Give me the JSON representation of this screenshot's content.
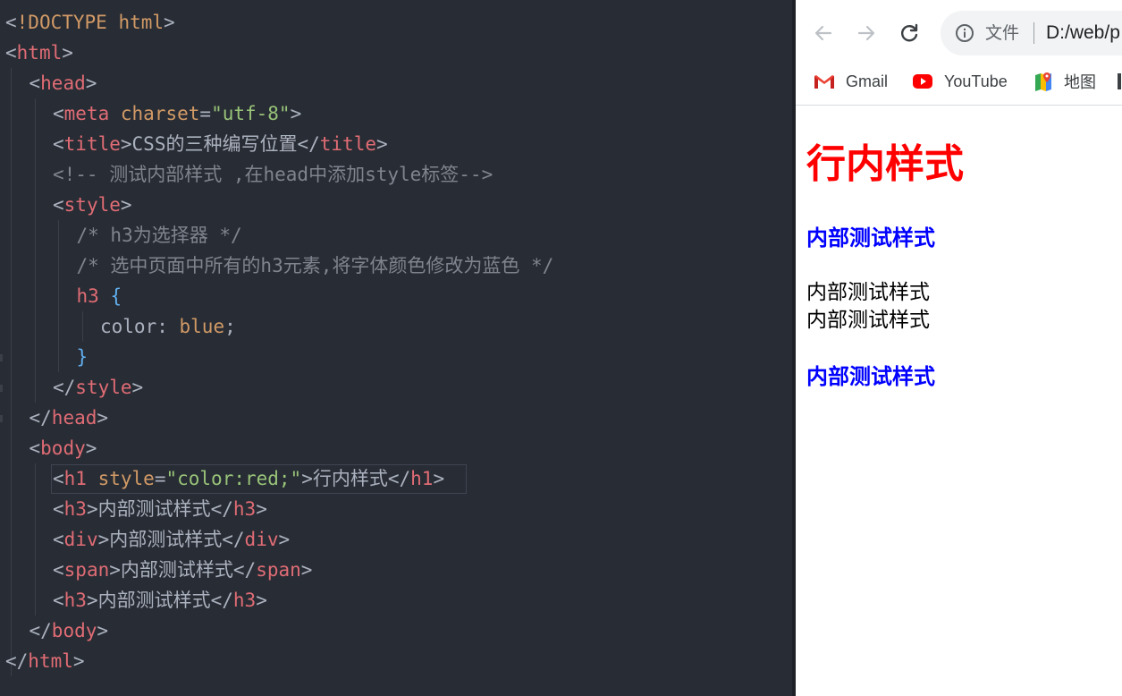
{
  "editor": {
    "lines": [
      {
        "indent": 0,
        "tokens": [
          [
            "t-punc",
            "<"
          ],
          [
            "t-doc",
            "!DOCTYPE"
          ],
          [
            "t-punc",
            " "
          ],
          [
            "t-attr",
            "html"
          ],
          [
            "t-punc",
            ">"
          ]
        ]
      },
      {
        "indent": 0,
        "tokens": [
          [
            "t-punc",
            "<"
          ],
          [
            "t-tag",
            "html"
          ],
          [
            "t-punc",
            ">"
          ]
        ]
      },
      {
        "indent": 1,
        "tokens": [
          [
            "t-punc",
            "<"
          ],
          [
            "t-tag",
            "head"
          ],
          [
            "t-punc",
            ">"
          ]
        ]
      },
      {
        "indent": 2,
        "tokens": [
          [
            "t-punc",
            "<"
          ],
          [
            "t-tag",
            "meta"
          ],
          [
            "t-punc",
            " "
          ],
          [
            "t-attr",
            "charset"
          ],
          [
            "t-punc",
            "="
          ],
          [
            "t-str",
            "\"utf-8\""
          ],
          [
            "t-punc",
            ">"
          ]
        ]
      },
      {
        "indent": 2,
        "tokens": [
          [
            "t-punc",
            "<"
          ],
          [
            "t-tag",
            "title"
          ],
          [
            "t-punc",
            ">"
          ],
          [
            "t-text",
            "CSS的三种编写位置"
          ],
          [
            "t-punc",
            "</"
          ],
          [
            "t-tag",
            "title"
          ],
          [
            "t-punc",
            ">"
          ]
        ]
      },
      {
        "indent": 2,
        "tokens": [
          [
            "t-com",
            "<!-- 测试内部样式 ,在head中添加style标签-->"
          ]
        ]
      },
      {
        "indent": 2,
        "tokens": [
          [
            "t-punc",
            "<"
          ],
          [
            "t-tag",
            "style"
          ],
          [
            "t-punc",
            ">"
          ]
        ]
      },
      {
        "indent": 3,
        "tokens": [
          [
            "t-com",
            "/* h3为选择器 */"
          ]
        ]
      },
      {
        "indent": 3,
        "tokens": [
          [
            "t-com",
            "/* 选中页面中所有的h3元素,将字体颜色修改为蓝色 */"
          ]
        ]
      },
      {
        "indent": 3,
        "tokens": [
          [
            "t-sel",
            "h3"
          ],
          [
            "t-punc",
            " "
          ],
          [
            "t-brace",
            "{"
          ]
        ]
      },
      {
        "indent": 4,
        "tokens": [
          [
            "t-prop",
            "color"
          ],
          [
            "t-punc",
            ": "
          ],
          [
            "t-val",
            "blue"
          ],
          [
            "t-punc",
            ";"
          ]
        ]
      },
      {
        "indent": 3,
        "tokens": [
          [
            "t-brace",
            "}"
          ]
        ]
      },
      {
        "indent": 2,
        "tokens": [
          [
            "t-punc",
            "</"
          ],
          [
            "t-tag",
            "style"
          ],
          [
            "t-punc",
            ">"
          ]
        ]
      },
      {
        "indent": 1,
        "tokens": [
          [
            "t-punc",
            "</"
          ],
          [
            "t-tag",
            "head"
          ],
          [
            "t-punc",
            ">"
          ]
        ]
      },
      {
        "indent": 1,
        "tokens": [
          [
            "t-punc",
            "<"
          ],
          [
            "t-tag",
            "body"
          ],
          [
            "t-punc",
            ">"
          ]
        ]
      },
      {
        "indent": 2,
        "tokens": [
          [
            "t-punc",
            "<"
          ],
          [
            "t-tag",
            "h1"
          ],
          [
            "t-punc",
            " "
          ],
          [
            "t-attr",
            "style"
          ],
          [
            "t-punc",
            "="
          ],
          [
            "t-str",
            "\"color:red;\""
          ],
          [
            "t-punc",
            ">"
          ],
          [
            "t-text",
            "行内样式"
          ],
          [
            "t-punc",
            "</"
          ],
          [
            "t-tag",
            "h1"
          ],
          [
            "t-punc",
            ">"
          ]
        ]
      },
      {
        "indent": 2,
        "tokens": [
          [
            "t-punc",
            "<"
          ],
          [
            "t-tag",
            "h3"
          ],
          [
            "t-punc",
            ">"
          ],
          [
            "t-text",
            "内部测试样式"
          ],
          [
            "t-punc",
            "</"
          ],
          [
            "t-tag",
            "h3"
          ],
          [
            "t-punc",
            ">"
          ]
        ]
      },
      {
        "indent": 2,
        "tokens": [
          [
            "t-punc",
            "<"
          ],
          [
            "t-tag",
            "div"
          ],
          [
            "t-punc",
            ">"
          ],
          [
            "t-text",
            "内部测试样式"
          ],
          [
            "t-punc",
            "</"
          ],
          [
            "t-tag",
            "div"
          ],
          [
            "t-punc",
            ">"
          ]
        ]
      },
      {
        "indent": 2,
        "tokens": [
          [
            "t-punc",
            "<"
          ],
          [
            "t-tag",
            "span"
          ],
          [
            "t-punc",
            ">"
          ],
          [
            "t-text",
            "内部测试样式"
          ],
          [
            "t-punc",
            "</"
          ],
          [
            "t-tag",
            "span"
          ],
          [
            "t-punc",
            ">"
          ]
        ]
      },
      {
        "indent": 2,
        "tokens": [
          [
            "t-punc",
            "<"
          ],
          [
            "t-tag",
            "h3"
          ],
          [
            "t-punc",
            ">"
          ],
          [
            "t-text",
            "内部测试样式"
          ],
          [
            "t-punc",
            "</"
          ],
          [
            "t-tag",
            "h3"
          ],
          [
            "t-punc",
            ">"
          ]
        ]
      },
      {
        "indent": 1,
        "tokens": [
          [
            "t-punc",
            "</"
          ],
          [
            "t-tag",
            "body"
          ],
          [
            "t-punc",
            ">"
          ]
        ]
      },
      {
        "indent": 0,
        "tokens": [
          [
            "t-punc",
            "</"
          ],
          [
            "t-tag",
            "html"
          ],
          [
            "t-punc",
            ">"
          ]
        ]
      }
    ]
  },
  "browser": {
    "address": {
      "info_icon": "info-icon",
      "label": "文件",
      "url": "D:/web/p"
    },
    "bookmarks": [
      {
        "label": "Gmail",
        "icon": "gmail-icon"
      },
      {
        "label": "YouTube",
        "icon": "youtube-icon"
      },
      {
        "label": "地图",
        "icon": "maps-icon"
      }
    ],
    "page": {
      "h1": "行内样式",
      "h3_first": "内部测试样式",
      "div_text": "内部测试样式",
      "span_text": "内部测试样式",
      "h3_second": "内部测试样式"
    },
    "colors": {
      "h1": "#ff0000",
      "h3": "#0000ff"
    }
  }
}
